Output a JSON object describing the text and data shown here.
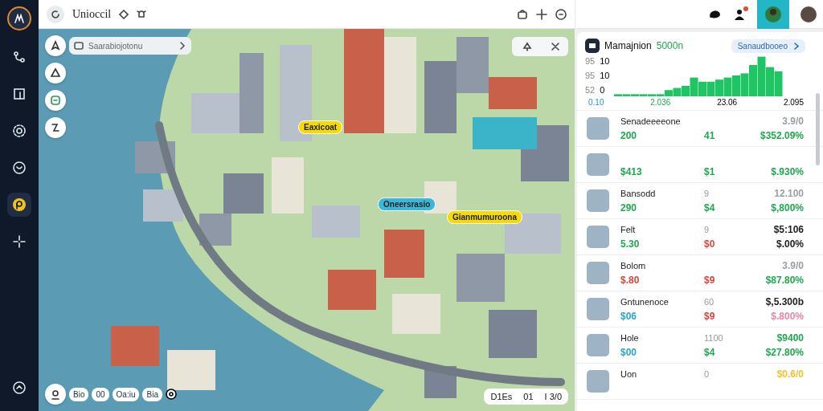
{
  "sidebar": {
    "items": [
      {
        "selected": false
      },
      {
        "selected": false
      },
      {
        "selected": false
      },
      {
        "selected": false
      },
      {
        "selected": true
      },
      {
        "selected": false
      }
    ]
  },
  "topbar": {
    "title": "Unioccil"
  },
  "map": {
    "search": {
      "placeholder": "Saarabiojotonu"
    },
    "labels": [
      {
        "text": "Eaxicoat",
        "color": "#f5d90a"
      },
      {
        "text": "Oneersrasio",
        "color": "#3bb8d8"
      },
      {
        "text": "Gianmumuroona",
        "color": "#f5d90a"
      }
    ],
    "chips": [
      "Bio",
      "00",
      "Oa:iu",
      "Bia"
    ],
    "scale": [
      "D1Es",
      "01",
      "I 3/0"
    ]
  },
  "panel": {
    "title": "Mamajnion",
    "title_value": "5000n",
    "action": "Sanaudbooeo",
    "y_axis": [
      {
        "prefix": "95",
        "value": "10"
      },
      {
        "prefix": "95",
        "value": "10"
      },
      {
        "prefix": "52",
        "value": "0"
      }
    ],
    "x_axis": [
      "0.10",
      "2.036",
      "23.06",
      "2.095"
    ],
    "rows": [
      {
        "name": "Senadeeeeone",
        "top": {
          "text": "3.9/0",
          "color": "#9aa0a6"
        },
        "a": {
          "text": "200",
          "color": "#1fa94f"
        },
        "b": {
          "text": "41",
          "color": "#1fa94f"
        },
        "c": {
          "text": "$352.09%",
          "color": "#1fa94f"
        }
      },
      {
        "a": {
          "text": "$413",
          "color": "#1fa94f"
        },
        "b": {
          "text": "$1",
          "color": "#1fa94f"
        },
        "c": {
          "text": "$.930%",
          "color": "#1fa94f"
        }
      },
      {
        "name": "Bansodd",
        "aux": "9",
        "top": {
          "text": "12.100",
          "color": "#9aa0a6"
        },
        "a": {
          "text": "290",
          "color": "#1fa94f"
        },
        "b": {
          "text": "$4",
          "color": "#1fa94f"
        },
        "c": {
          "text": "$,800%",
          "color": "#1fa94f"
        }
      },
      {
        "name": "Felt",
        "aux": "9",
        "top": {
          "text": "$5:106",
          "color": "#222222"
        },
        "a": {
          "text": "5.30",
          "color": "#1fa94f"
        },
        "b": {
          "text": "$0",
          "color": "#e0443a"
        },
        "c": {
          "text": "$.00%",
          "color": "#222222"
        }
      },
      {
        "name": "Bolom",
        "top": {
          "text": "3.9/0",
          "color": "#9aa0a6"
        },
        "a": {
          "text": "$.80",
          "color": "#e0443a"
        },
        "b": {
          "text": "$9",
          "color": "#e0443a"
        },
        "c": {
          "text": "$87.80%",
          "color": "#1fa94f"
        }
      },
      {
        "name": "Gntunenoce",
        "aux": "60",
        "top": {
          "text": "$,5.300b",
          "color": "#222222"
        },
        "a": {
          "text": "$06",
          "color": "#2aa7c9"
        },
        "b": {
          "text": "$9",
          "color": "#e0443a"
        },
        "c": {
          "text": "$.800%",
          "color": "#e38aa8"
        }
      },
      {
        "name": "Hole",
        "aux": "1100",
        "top": {
          "text": "$9400",
          "color": "#1fa94f"
        },
        "a": {
          "text": "$00",
          "color": "#2aa7c9"
        },
        "b": {
          "text": "$4",
          "color": "#1fa94f"
        },
        "c": {
          "text": "$27.80%",
          "color": "#1fa94f"
        }
      },
      {
        "name": "Uon",
        "aux": "0",
        "top": {
          "text": "$0.6/0",
          "color": "#f2c230"
        }
      }
    ]
  }
}
